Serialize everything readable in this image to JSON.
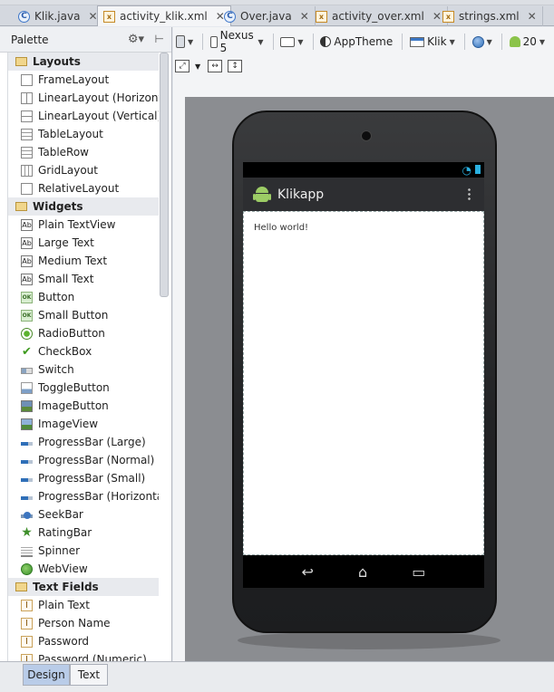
{
  "tabs": [
    {
      "label": "Klik.java",
      "type": "java",
      "active": false
    },
    {
      "label": "activity_klik.xml",
      "type": "xml",
      "active": true
    },
    {
      "label": "Over.java",
      "type": "java",
      "active": false
    },
    {
      "label": "activity_over.xml",
      "type": "xml",
      "active": false
    },
    {
      "label": "strings.xml",
      "type": "xml",
      "active": false
    }
  ],
  "palette": {
    "title": "Palette",
    "categories": [
      {
        "label": "Layouts"
      },
      {
        "label": "Widgets"
      },
      {
        "label": "Text Fields"
      }
    ],
    "layouts": [
      {
        "label": "FrameLayout",
        "icon": "framelayout-icon"
      },
      {
        "label": "LinearLayout (Horizontal)",
        "icon": "linearlayout-horizontal-icon"
      },
      {
        "label": "LinearLayout (Vertical)",
        "icon": "linearlayout-vertical-icon"
      },
      {
        "label": "TableLayout",
        "icon": "tablelayout-icon"
      },
      {
        "label": "TableRow",
        "icon": "tablerow-icon"
      },
      {
        "label": "GridLayout",
        "icon": "gridlayout-icon"
      },
      {
        "label": "RelativeLayout",
        "icon": "relativelayout-icon"
      }
    ],
    "widgets": [
      {
        "label": "Plain TextView",
        "icon": "textview-icon"
      },
      {
        "label": "Large Text",
        "icon": "textview-icon"
      },
      {
        "label": "Medium Text",
        "icon": "textview-icon"
      },
      {
        "label": "Small Text",
        "icon": "textview-icon"
      },
      {
        "label": "Button",
        "icon": "button-icon"
      },
      {
        "label": "Small Button",
        "icon": "button-icon"
      },
      {
        "label": "RadioButton",
        "icon": "radiobutton-icon"
      },
      {
        "label": "CheckBox",
        "icon": "checkbox-icon"
      },
      {
        "label": "Switch",
        "icon": "switch-icon"
      },
      {
        "label": "ToggleButton",
        "icon": "togglebutton-icon"
      },
      {
        "label": "ImageButton",
        "icon": "imagebutton-icon"
      },
      {
        "label": "ImageView",
        "icon": "imageview-icon"
      },
      {
        "label": "ProgressBar (Large)",
        "icon": "progressbar-icon"
      },
      {
        "label": "ProgressBar (Normal)",
        "icon": "progressbar-icon"
      },
      {
        "label": "ProgressBar (Small)",
        "icon": "progressbar-icon"
      },
      {
        "label": "ProgressBar (Horizontal)",
        "icon": "progressbar-icon"
      },
      {
        "label": "SeekBar",
        "icon": "seekbar-icon"
      },
      {
        "label": "RatingBar",
        "icon": "ratingbar-icon"
      },
      {
        "label": "Spinner",
        "icon": "spinner-icon"
      },
      {
        "label": "WebView",
        "icon": "webview-icon"
      }
    ],
    "textfields": [
      {
        "label": "Plain Text",
        "icon": "textfield-icon"
      },
      {
        "label": "Person Name",
        "icon": "textfield-icon"
      },
      {
        "label": "Password",
        "icon": "textfield-icon"
      },
      {
        "label": "Password (Numeric)",
        "icon": "textfield-icon"
      }
    ]
  },
  "toolbar": {
    "device": "Nexus 5",
    "theme": "AppTheme",
    "activity": "Klik",
    "api": "20"
  },
  "preview": {
    "app_title": "Klikapp",
    "hello_text": "Hello world!"
  },
  "bottom_tabs": [
    {
      "label": "Design",
      "active": true
    },
    {
      "label": "Text",
      "active": false
    }
  ]
}
